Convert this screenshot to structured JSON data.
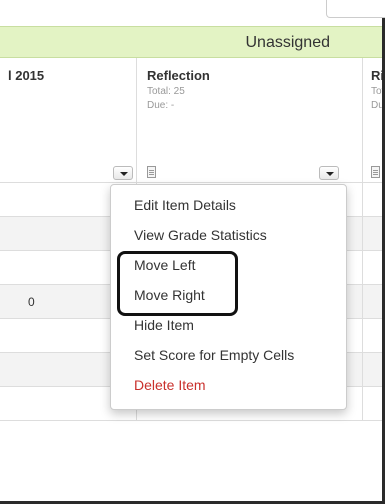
{
  "header": {
    "category_band": "Unassigned"
  },
  "columns": [
    {
      "title": "l 2015"
    },
    {
      "title": "Reflection",
      "total": "Total: 25",
      "due": "Due: -"
    },
    {
      "title": "Riv",
      "total": "Tota",
      "due": "Due:"
    }
  ],
  "rows": [
    {
      "value": ""
    },
    {
      "value": ""
    },
    {
      "value": ""
    },
    {
      "value": "0"
    },
    {
      "value": ""
    },
    {
      "value": ""
    },
    {
      "value": ""
    }
  ],
  "context_menu": {
    "items": [
      {
        "label": "Edit Item Details"
      },
      {
        "label": "View Grade Statistics"
      },
      {
        "label": "Move Left"
      },
      {
        "label": "Move Right"
      },
      {
        "label": "Hide Item"
      },
      {
        "label": "Set Score for Empty Cells"
      },
      {
        "label": "Delete Item"
      }
    ]
  },
  "colors": {
    "band": "#e3f3c4",
    "danger": "#c9302c",
    "highlight": "#111111"
  }
}
